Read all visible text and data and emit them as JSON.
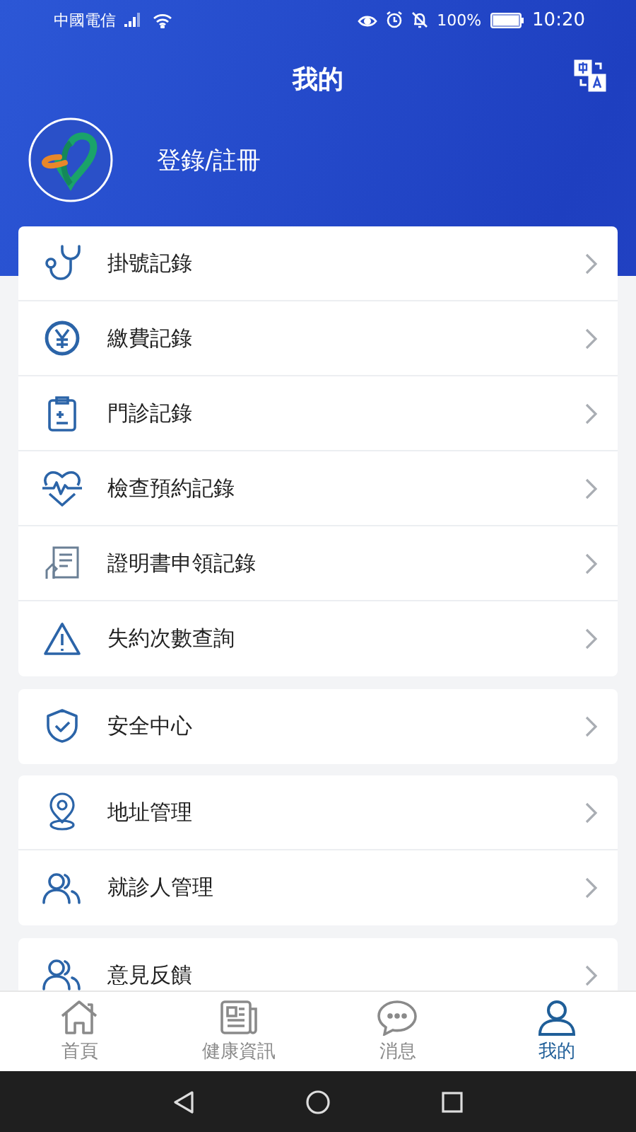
{
  "status_bar": {
    "carrier": "中國電信",
    "battery": "100%",
    "time": "10:20"
  },
  "header": {
    "title": "我的"
  },
  "profile": {
    "login": "登錄/註冊"
  },
  "menu_groups": [
    {
      "items": [
        {
          "label": "掛號記錄"
        },
        {
          "label": "繳費記錄"
        },
        {
          "label": "門診記錄"
        },
        {
          "label": "檢查預約記錄"
        },
        {
          "label": "證明書申領記錄"
        },
        {
          "label": "失約次數查詢"
        }
      ]
    },
    {
      "items": [
        {
          "label": "安全中心"
        }
      ]
    },
    {
      "items": [
        {
          "label": "地址管理"
        },
        {
          "label": "就診人管理"
        }
      ]
    },
    {
      "items": [
        {
          "label": "意見反饋"
        }
      ]
    }
  ],
  "tab_bar": [
    {
      "label": "首頁",
      "selected": false
    },
    {
      "label": "健康資訊",
      "selected": false
    },
    {
      "label": "消息",
      "selected": false
    },
    {
      "label": "我的",
      "selected": true
    }
  ]
}
